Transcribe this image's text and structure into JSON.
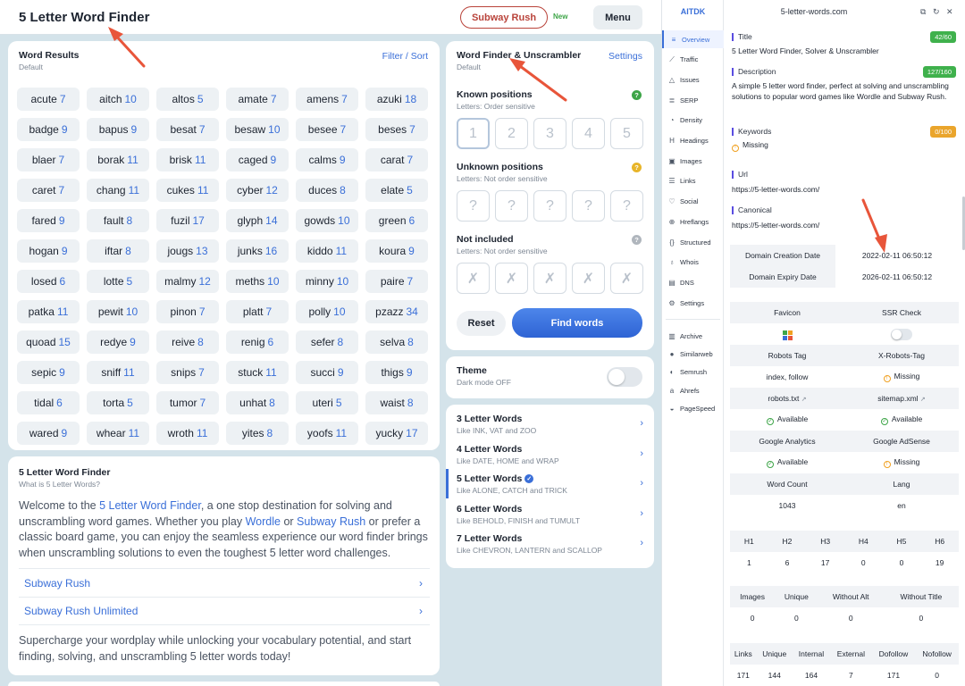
{
  "header": {
    "site_title": "5 Letter Word Finder",
    "subway_button": "Subway Rush",
    "new_badge": "New",
    "menu_button": "Menu"
  },
  "results": {
    "title": "Word Results",
    "subtitle": "Default",
    "filter_link": "Filter / Sort",
    "words": [
      {
        "w": "acute",
        "n": "7"
      },
      {
        "w": "aitch",
        "n": "10"
      },
      {
        "w": "altos",
        "n": "5"
      },
      {
        "w": "amate",
        "n": "7"
      },
      {
        "w": "amens",
        "n": "7"
      },
      {
        "w": "azuki",
        "n": "18"
      },
      {
        "w": "badge",
        "n": "9"
      },
      {
        "w": "bapus",
        "n": "9"
      },
      {
        "w": "besat",
        "n": "7"
      },
      {
        "w": "besaw",
        "n": "10"
      },
      {
        "w": "besee",
        "n": "7"
      },
      {
        "w": "beses",
        "n": "7"
      },
      {
        "w": "blaer",
        "n": "7"
      },
      {
        "w": "borak",
        "n": "11"
      },
      {
        "w": "brisk",
        "n": "11"
      },
      {
        "w": "caged",
        "n": "9"
      },
      {
        "w": "calms",
        "n": "9"
      },
      {
        "w": "carat",
        "n": "7"
      },
      {
        "w": "caret",
        "n": "7"
      },
      {
        "w": "chang",
        "n": "11"
      },
      {
        "w": "cukes",
        "n": "11"
      },
      {
        "w": "cyber",
        "n": "12"
      },
      {
        "w": "duces",
        "n": "8"
      },
      {
        "w": "elate",
        "n": "5"
      },
      {
        "w": "fared",
        "n": "9"
      },
      {
        "w": "fault",
        "n": "8"
      },
      {
        "w": "fuzil",
        "n": "17"
      },
      {
        "w": "glyph",
        "n": "14"
      },
      {
        "w": "gowds",
        "n": "10"
      },
      {
        "w": "green",
        "n": "6"
      },
      {
        "w": "hogan",
        "n": "9"
      },
      {
        "w": "iftar",
        "n": "8"
      },
      {
        "w": "jougs",
        "n": "13"
      },
      {
        "w": "junks",
        "n": "16"
      },
      {
        "w": "kiddo",
        "n": "11"
      },
      {
        "w": "koura",
        "n": "9"
      },
      {
        "w": "losed",
        "n": "6"
      },
      {
        "w": "lotte",
        "n": "5"
      },
      {
        "w": "malmy",
        "n": "12"
      },
      {
        "w": "meths",
        "n": "10"
      },
      {
        "w": "minny",
        "n": "10"
      },
      {
        "w": "paire",
        "n": "7"
      },
      {
        "w": "patka",
        "n": "11"
      },
      {
        "w": "pewit",
        "n": "10"
      },
      {
        "w": "pinon",
        "n": "7"
      },
      {
        "w": "platt",
        "n": "7"
      },
      {
        "w": "polly",
        "n": "10"
      },
      {
        "w": "pzazz",
        "n": "34"
      },
      {
        "w": "quoad",
        "n": "15"
      },
      {
        "w": "redye",
        "n": "9"
      },
      {
        "w": "reive",
        "n": "8"
      },
      {
        "w": "renig",
        "n": "6"
      },
      {
        "w": "sefer",
        "n": "8"
      },
      {
        "w": "selva",
        "n": "8"
      },
      {
        "w": "sepic",
        "n": "9"
      },
      {
        "w": "sniff",
        "n": "11"
      },
      {
        "w": "snips",
        "n": "7"
      },
      {
        "w": "stuck",
        "n": "11"
      },
      {
        "w": "succi",
        "n": "9"
      },
      {
        "w": "thigs",
        "n": "9"
      },
      {
        "w": "tidal",
        "n": "6"
      },
      {
        "w": "torta",
        "n": "5"
      },
      {
        "w": "tumor",
        "n": "7"
      },
      {
        "w": "unhat",
        "n": "8"
      },
      {
        "w": "uteri",
        "n": "5"
      },
      {
        "w": "waist",
        "n": "8"
      },
      {
        "w": "wared",
        "n": "9"
      },
      {
        "w": "whear",
        "n": "11"
      },
      {
        "w": "wroth",
        "n": "11"
      },
      {
        "w": "yites",
        "n": "8"
      },
      {
        "w": "yoofs",
        "n": "11"
      },
      {
        "w": "yucky",
        "n": "17"
      }
    ]
  },
  "finder": {
    "title": "Word Finder & Unscrambler",
    "subtitle": "Default",
    "settings_link": "Settings",
    "known": {
      "title": "Known positions",
      "sub": "Letters: Order sensitive",
      "help": "?",
      "boxes": [
        "1",
        "2",
        "3",
        "4",
        "5"
      ]
    },
    "unknown": {
      "title": "Unknown positions",
      "sub": "Letters: Not order sensitive",
      "help": "?",
      "boxes": [
        "?",
        "?",
        "?",
        "?",
        "?"
      ]
    },
    "excluded": {
      "title": "Not included",
      "sub": "Letters: Not order sensitive",
      "help": "?",
      "boxes": [
        "✗",
        "✗",
        "✗",
        "✗",
        "✗"
      ]
    },
    "reset_button": "Reset",
    "find_button": "Find words"
  },
  "theme": {
    "title": "Theme",
    "sub": "Dark mode OFF"
  },
  "word_lists": [
    {
      "title": "3 Letter Words",
      "sub": "Like INK, VAT and ZOO"
    },
    {
      "title": "4 Letter Words",
      "sub": "Like DATE, HOME and WRAP"
    },
    {
      "title": "5 Letter Words",
      "sub": "Like ALONE, CATCH and TRICK"
    },
    {
      "title": "6 Letter Words",
      "sub": "Like BEHOLD, FINISH and TUMULT"
    },
    {
      "title": "7 Letter Words",
      "sub": "Like CHEVRON, LANTERN and SCALLOP"
    }
  ],
  "article": {
    "title": "5 Letter Word Finder",
    "subtitle": "What is 5 Letter Words?",
    "p1_a": "Welcome to the ",
    "p1_link1": "5 Letter Word Finder",
    "p1_b": ", a one stop destination for solving and unscrambling word games. Whether you play ",
    "p1_link2": "Wordle",
    "p1_c": " or ",
    "p1_link3": "Subway Rush",
    "p1_d": " or prefer a classic board game, you can enjoy the seamless experience our word finder brings when unscrambling solutions to even the toughest 5 letter word challenges.",
    "links": [
      "Subway Rush",
      "Subway Rush Unlimited"
    ],
    "p2": "Supercharge your wordplay while unlocking your vocabulary potential, and start finding, solving, and unscrambling 5 letter words today!"
  },
  "ext": {
    "brand": "AITDK",
    "domain": "5-letter-words.com",
    "nav": [
      {
        "label": "Overview",
        "icon": "≡"
      },
      {
        "label": "Traffic",
        "icon": "⟋"
      },
      {
        "label": "Issues",
        "icon": "△"
      },
      {
        "label": "SERP",
        "icon": "≣"
      },
      {
        "label": "Density",
        "icon": "◔"
      },
      {
        "label": "Headings",
        "icon": "H"
      },
      {
        "label": "Images",
        "icon": "▣"
      },
      {
        "label": "Links",
        "icon": "☰"
      },
      {
        "label": "Social",
        "icon": "♡"
      },
      {
        "label": "Hreflangs",
        "icon": "⊕"
      },
      {
        "label": "Structured",
        "icon": "{}"
      },
      {
        "label": "Whois",
        "icon": "♁"
      },
      {
        "label": "DNS",
        "icon": "▤"
      },
      {
        "label": "Settings",
        "icon": "⚙"
      }
    ],
    "nav2": [
      {
        "label": "Archive",
        "icon": "▥"
      },
      {
        "label": "Similarweb",
        "icon": "●"
      },
      {
        "label": "Semrush",
        "icon": "◐"
      },
      {
        "label": "Ahrefs",
        "icon": "a"
      },
      {
        "label": "PageSpeed",
        "icon": "◒"
      }
    ],
    "title_label": "Title",
    "title_count": "42/60",
    "title_value": "5 Letter Word Finder, Solver & Unscrambler",
    "desc_label": "Description",
    "desc_count": "127/160",
    "desc_value": "A simple 5 letter word finder, perfect at solving and unscrambling solutions to popular word games like Wordle and Subway Rush.",
    "kw_label": "Keywords",
    "kw_count": "0/100",
    "kw_value": "Missing",
    "url_label": "Url",
    "url_value": "https://5-letter-words.com/",
    "canon_label": "Canonical",
    "canon_value": "https://5-letter-words.com/",
    "creation_label": "Domain Creation Date",
    "creation_value": "2022-02-11 06:50:12",
    "expiry_label": "Domain Expiry Date",
    "expiry_value": "2026-02-11 06:50:12",
    "favicon_label": "Favicon",
    "ssr_label": "SSR Check",
    "robots_label": "Robots Tag",
    "xrobots_label": "X-Robots-Tag",
    "robots_value": "index, follow",
    "xrobots_value": "Missing",
    "robotstxt_label": "robots.txt",
    "sitemap_label": "sitemap.xml",
    "robotstxt_value": "Available",
    "sitemap_value": "Available",
    "ga_label": "Google Analytics",
    "ads_label": "Google AdSense",
    "ga_value": "Available",
    "ads_value": "Missing",
    "wc_label": "Word Count",
    "lang_label": "Lang",
    "wc_value": "1043",
    "lang_value": "en",
    "h_labels": [
      "H1",
      "H2",
      "H3",
      "H4",
      "H5",
      "H6"
    ],
    "h_values": [
      "1",
      "6",
      "17",
      "0",
      "0",
      "19"
    ],
    "img_labels": [
      "Images",
      "Unique",
      "Without Alt",
      "Without Title"
    ],
    "img_values": [
      "0",
      "0",
      "0",
      "0"
    ],
    "link_labels": [
      "Links",
      "Unique",
      "Internal",
      "External",
      "Dofollow",
      "Nofollow"
    ],
    "link_values": [
      "171",
      "144",
      "164",
      "7",
      "171",
      "0"
    ]
  }
}
